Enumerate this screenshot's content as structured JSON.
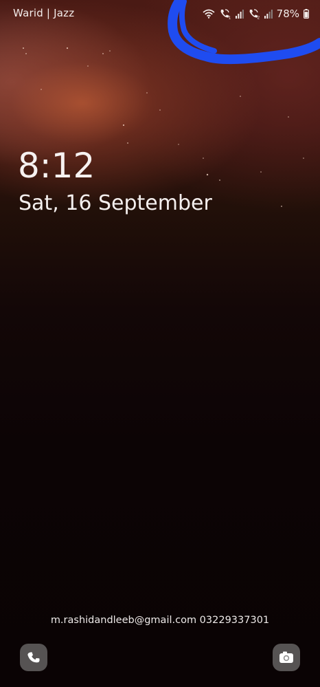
{
  "status_bar": {
    "carrier": "Warid | Jazz",
    "battery_percent": "78%",
    "icons": [
      "wifi-icon",
      "volte-call-icon-sim1",
      "signal-icon-sim1",
      "volte-call-icon-sim2",
      "signal-icon-sim2",
      "battery-icon"
    ]
  },
  "lock_screen": {
    "time": "8:12",
    "date": "Sat, 16 September",
    "owner_info": "m.rashidandleeb@gmail.com 03229337301"
  },
  "shortcuts": {
    "left": "phone-icon",
    "right": "camera-icon"
  },
  "colors": {
    "annotation_stroke": "#1f4cf0",
    "shortcut_bg": "#8f8f8f"
  }
}
